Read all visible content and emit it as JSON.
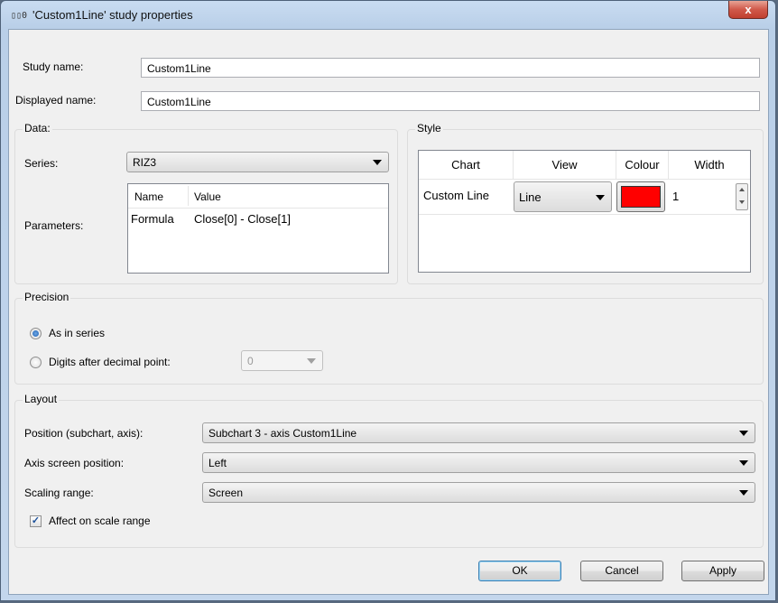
{
  "window": {
    "title": "'Custom1Line' study properties",
    "icon": "study-icon",
    "close_label": "x"
  },
  "study_name": {
    "label": "Study name:",
    "value": "Custom1Line"
  },
  "displayed_name": {
    "label": "Displayed name:",
    "value": "Custom1Line"
  },
  "data_group": {
    "title": "Data:",
    "series_label": "Series:",
    "series_value": "RIZ3",
    "parameters_label": "Parameters:",
    "param_headers": [
      "Name",
      "Value"
    ],
    "params": [
      {
        "name": "Formula",
        "value": "Close[0] - Close[1]"
      }
    ]
  },
  "style_group": {
    "title": "Style",
    "headers": [
      "Chart",
      "View",
      "Colour",
      "Width"
    ],
    "row": {
      "chart": "Custom Line",
      "view": "Line",
      "colour": "#ff0000",
      "width": "1"
    }
  },
  "precision_group": {
    "title": "Precision",
    "as_in_series": "As in series",
    "digits_label": "Digits after decimal point:",
    "digits_value": "0",
    "selected": "as_in_series"
  },
  "layout_group": {
    "title": "Layout",
    "position_label": "Position (subchart, axis):",
    "position_value": "Subchart 3 - axis Custom1Line",
    "axis_label": "Axis screen position:",
    "axis_value": "Left",
    "scaling_label": "Scaling range:",
    "scaling_value": "Screen",
    "affect_label": "Affect on scale range",
    "affect_checked": true
  },
  "buttons": {
    "ok": "OK",
    "cancel": "Cancel",
    "apply": "Apply"
  }
}
